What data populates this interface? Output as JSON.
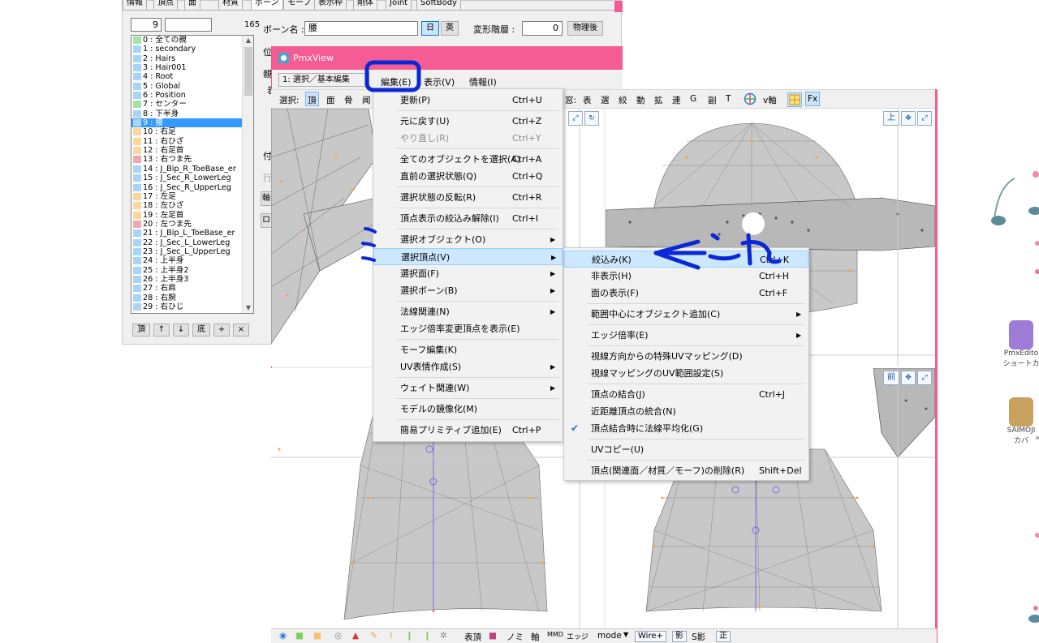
{
  "pmxeditor": {
    "tabs": [
      "情報",
      "頂点",
      "面",
      "材質",
      "ボーン",
      "モーフ",
      "表示枠",
      "剛体",
      "Joint",
      "SoftBody"
    ],
    "bone_index": "9",
    "bone_count": "165",
    "bone_name_label": "ボーン名 :",
    "bone_name_value": "腰",
    "lang_jp": "日",
    "lang_en": "英",
    "deform_label": "変形階層 :",
    "deform_value": "0",
    "physics_after": "物理後",
    "pos_label": "位",
    "cut_labels": [
      "親",
      "表",
      "付",
      "行",
      "軸",
      "ロ"
    ],
    "bones": [
      {
        "label": "0 : 全ての親",
        "color": "#a6e3a1"
      },
      {
        "label": "1 : secondary",
        "color": "#a8d4f7"
      },
      {
        "label": "2 : Hairs",
        "color": "#a8d4f7"
      },
      {
        "label": "3 : Hair001",
        "color": "#a8d4f7"
      },
      {
        "label": "4 : Root",
        "color": "#a8d4f7"
      },
      {
        "label": "5 : Global",
        "color": "#a8d4f7"
      },
      {
        "label": "6 : Position",
        "color": "#a8d4f7"
      },
      {
        "label": "7 : センター",
        "color": "#a6e3a1"
      },
      {
        "label": "8 : 下半身",
        "color": "#a8d4f7"
      },
      {
        "label": "9 : 腰",
        "color": "#a8d4f7",
        "selected": true
      },
      {
        "label": "10 : 右足",
        "color": "#fbd7a0"
      },
      {
        "label": "11 : 右ひざ",
        "color": "#fbd7a0"
      },
      {
        "label": "12 : 右足首",
        "color": "#fbd7a0"
      },
      {
        "label": "13 : 右つま先",
        "color": "#f4a6b0"
      },
      {
        "label": "14 : J_Bip_R_ToeBase_er",
        "color": "#a8d4f7"
      },
      {
        "label": "15 : J_Sec_R_LowerLeg",
        "color": "#a8d4f7"
      },
      {
        "label": "16 : J_Sec_R_UpperLeg",
        "color": "#a8d4f7"
      },
      {
        "label": "17 : 左足",
        "color": "#fbd7a0"
      },
      {
        "label": "18 : 左ひざ",
        "color": "#fbd7a0"
      },
      {
        "label": "19 : 左足首",
        "color": "#fbd7a0"
      },
      {
        "label": "20 : 左つま先",
        "color": "#f4a6b0"
      },
      {
        "label": "21 : J_Bip_L_ToeBase_er",
        "color": "#a8d4f7"
      },
      {
        "label": "22 : J_Sec_L_LowerLeg",
        "color": "#a8d4f7"
      },
      {
        "label": "23 : J_Sec_L_UpperLeg",
        "color": "#a8d4f7"
      },
      {
        "label": "24 : 上半身",
        "color": "#a8d4f7"
      },
      {
        "label": "25 : 上半身2",
        "color": "#a8d4f7"
      },
      {
        "label": "26 : 上半身3",
        "color": "#a8d4f7"
      },
      {
        "label": "27 : 右肩",
        "color": "#a8d4f7"
      },
      {
        "label": "28 : 右腕",
        "color": "#a8d4f7"
      },
      {
        "label": "29 : 右ひじ",
        "color": "#a8d4f7"
      }
    ],
    "list_buttons": [
      "頂",
      "↑",
      "↓",
      "底",
      "+",
      "×"
    ]
  },
  "pmxview": {
    "title": "PmxView",
    "mode_combo": "1: 選択／基本編集",
    "menu": [
      "編集(E)",
      "表示(V)",
      "情報(I)"
    ],
    "toolbar": {
      "select_label": "選択:",
      "select_modes": [
        "頂",
        "面",
        "骨",
        "闻"
      ],
      "window_label": "窓:",
      "window_items": [
        "表",
        "選",
        "絞",
        "動",
        "拡",
        "連",
        "G",
        "副",
        "T"
      ],
      "v_axis": "v軸",
      "fx": "Fx"
    },
    "views": [
      "上",
      "前"
    ],
    "bottombar": {
      "items": [
        "表頂",
        "ノミ",
        "軸",
        "MMD",
        "エッジ",
        "mode",
        "Wire+",
        "影",
        "S影",
        "正"
      ]
    }
  },
  "edit_menu": {
    "items": [
      {
        "label": "更新(P)",
        "shortcut": "Ctrl+U"
      },
      {
        "sep": true
      },
      {
        "label": "元に戻す(U)",
        "shortcut": "Ctrl+Z"
      },
      {
        "label": "やり直し(R)",
        "shortcut": "Ctrl+Y",
        "disabled": true
      },
      {
        "sep": true
      },
      {
        "label": "全てのオブジェクトを選択(A)",
        "shortcut": "Ctrl+A"
      },
      {
        "label": "直前の選択状態(Q)",
        "shortcut": "Ctrl+Q"
      },
      {
        "sep": true
      },
      {
        "label": "選択状態の反転(R)",
        "shortcut": "Ctrl+R"
      },
      {
        "sep": true
      },
      {
        "label": "頂点表示の絞込み解除(I)",
        "shortcut": "Ctrl+I"
      },
      {
        "sep": true
      },
      {
        "label": "選択オブジェクト(O)",
        "sub": true
      },
      {
        "label": "選択頂点(V)",
        "sub": true,
        "highlighted": true
      },
      {
        "label": "選択面(F)",
        "sub": true
      },
      {
        "label": "選択ボーン(B)",
        "sub": true
      },
      {
        "sep": true
      },
      {
        "label": "法線関連(N)",
        "sub": true
      },
      {
        "label": "エッジ倍率変更頂点を表示(E)"
      },
      {
        "sep": true
      },
      {
        "label": "モーフ編集(K)"
      },
      {
        "label": "UV表情作成(S)",
        "sub": true
      },
      {
        "sep": true
      },
      {
        "label": "ウェイト関連(W)",
        "sub": true
      },
      {
        "sep": true
      },
      {
        "label": "モデルの鏡像化(M)"
      },
      {
        "sep": true
      },
      {
        "label": "簡易プリミティブ追加(E)",
        "shortcut": "Ctrl+P"
      }
    ]
  },
  "vertex_submenu": {
    "items": [
      {
        "label": "絞込み(K)",
        "shortcut": "Ctrl+K",
        "highlighted": true
      },
      {
        "label": "非表示(H)",
        "shortcut": "Ctrl+H"
      },
      {
        "label": "面の表示(F)",
        "shortcut": "Ctrl+F"
      },
      {
        "sep": true
      },
      {
        "label": "範囲中心にオブジェクト追加(C)",
        "sub": true
      },
      {
        "sep": true
      },
      {
        "label": "エッジ倍率(E)",
        "sub": true
      },
      {
        "sep": true
      },
      {
        "label": "視線方向からの特殊UVマッピング(D)"
      },
      {
        "label": "視線マッピングのUV範囲設定(S)"
      },
      {
        "sep": true
      },
      {
        "label": "頂点の結合(J)",
        "shortcut": "Ctrl+J"
      },
      {
        "label": "近距離頂点の統合(N)"
      },
      {
        "label": "頂点結合時に法線平均化(G)",
        "checked": true
      },
      {
        "sep": true
      },
      {
        "label": "UVコピー(U)"
      },
      {
        "sep": true
      },
      {
        "label": "頂点(関連面／材質／モーフ)の削除(R)",
        "shortcut": "Shift+Del"
      }
    ]
  },
  "annotation": {
    "text": "←これ",
    "mark": "ミ",
    "color": "#0b28d6"
  },
  "desktop": {
    "icons": [
      {
        "label": "PmxEdito\nショートカ"
      },
      {
        "label": "SAIMOJI\nカバ"
      }
    ]
  }
}
